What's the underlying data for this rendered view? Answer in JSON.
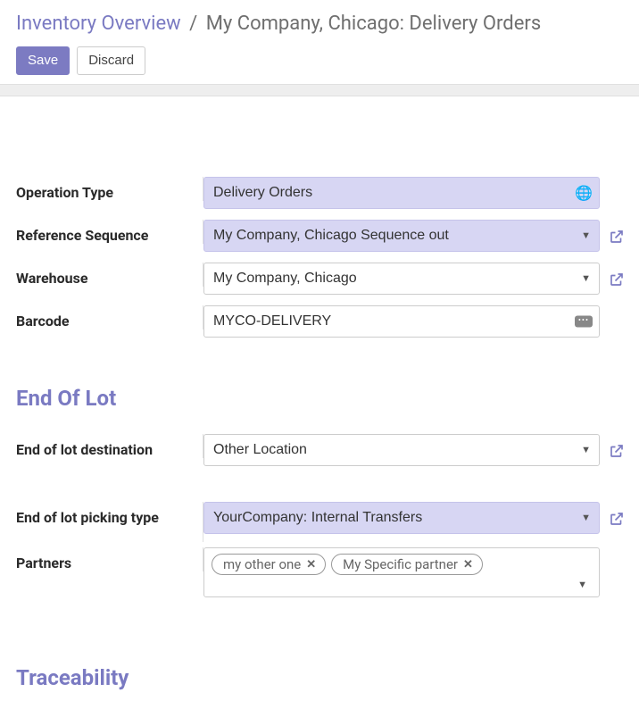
{
  "breadcrumb": {
    "root": "Inventory Overview",
    "separator": "/",
    "current": "My Company, Chicago: Delivery Orders"
  },
  "buttons": {
    "save": "Save",
    "discard": "Discard"
  },
  "fields": {
    "operation_type": {
      "label": "Operation Type",
      "value": "Delivery Orders"
    },
    "reference_sequence": {
      "label": "Reference Sequence",
      "value": "My Company, Chicago Sequence out"
    },
    "warehouse": {
      "label": "Warehouse",
      "value": "My Company, Chicago"
    },
    "barcode": {
      "label": "Barcode",
      "value": "MYCO-DELIVERY"
    }
  },
  "sections": {
    "end_of_lot": "End Of Lot",
    "traceability": "Traceability"
  },
  "end_of_lot": {
    "destination": {
      "label": "End of lot destination",
      "value": "Other Location"
    },
    "picking_type": {
      "label": "End of lot picking type",
      "value": "YourCompany: Internal Transfers"
    },
    "partners": {
      "label": "Partners",
      "tags": [
        "my other one",
        "My Specific partner"
      ]
    }
  }
}
